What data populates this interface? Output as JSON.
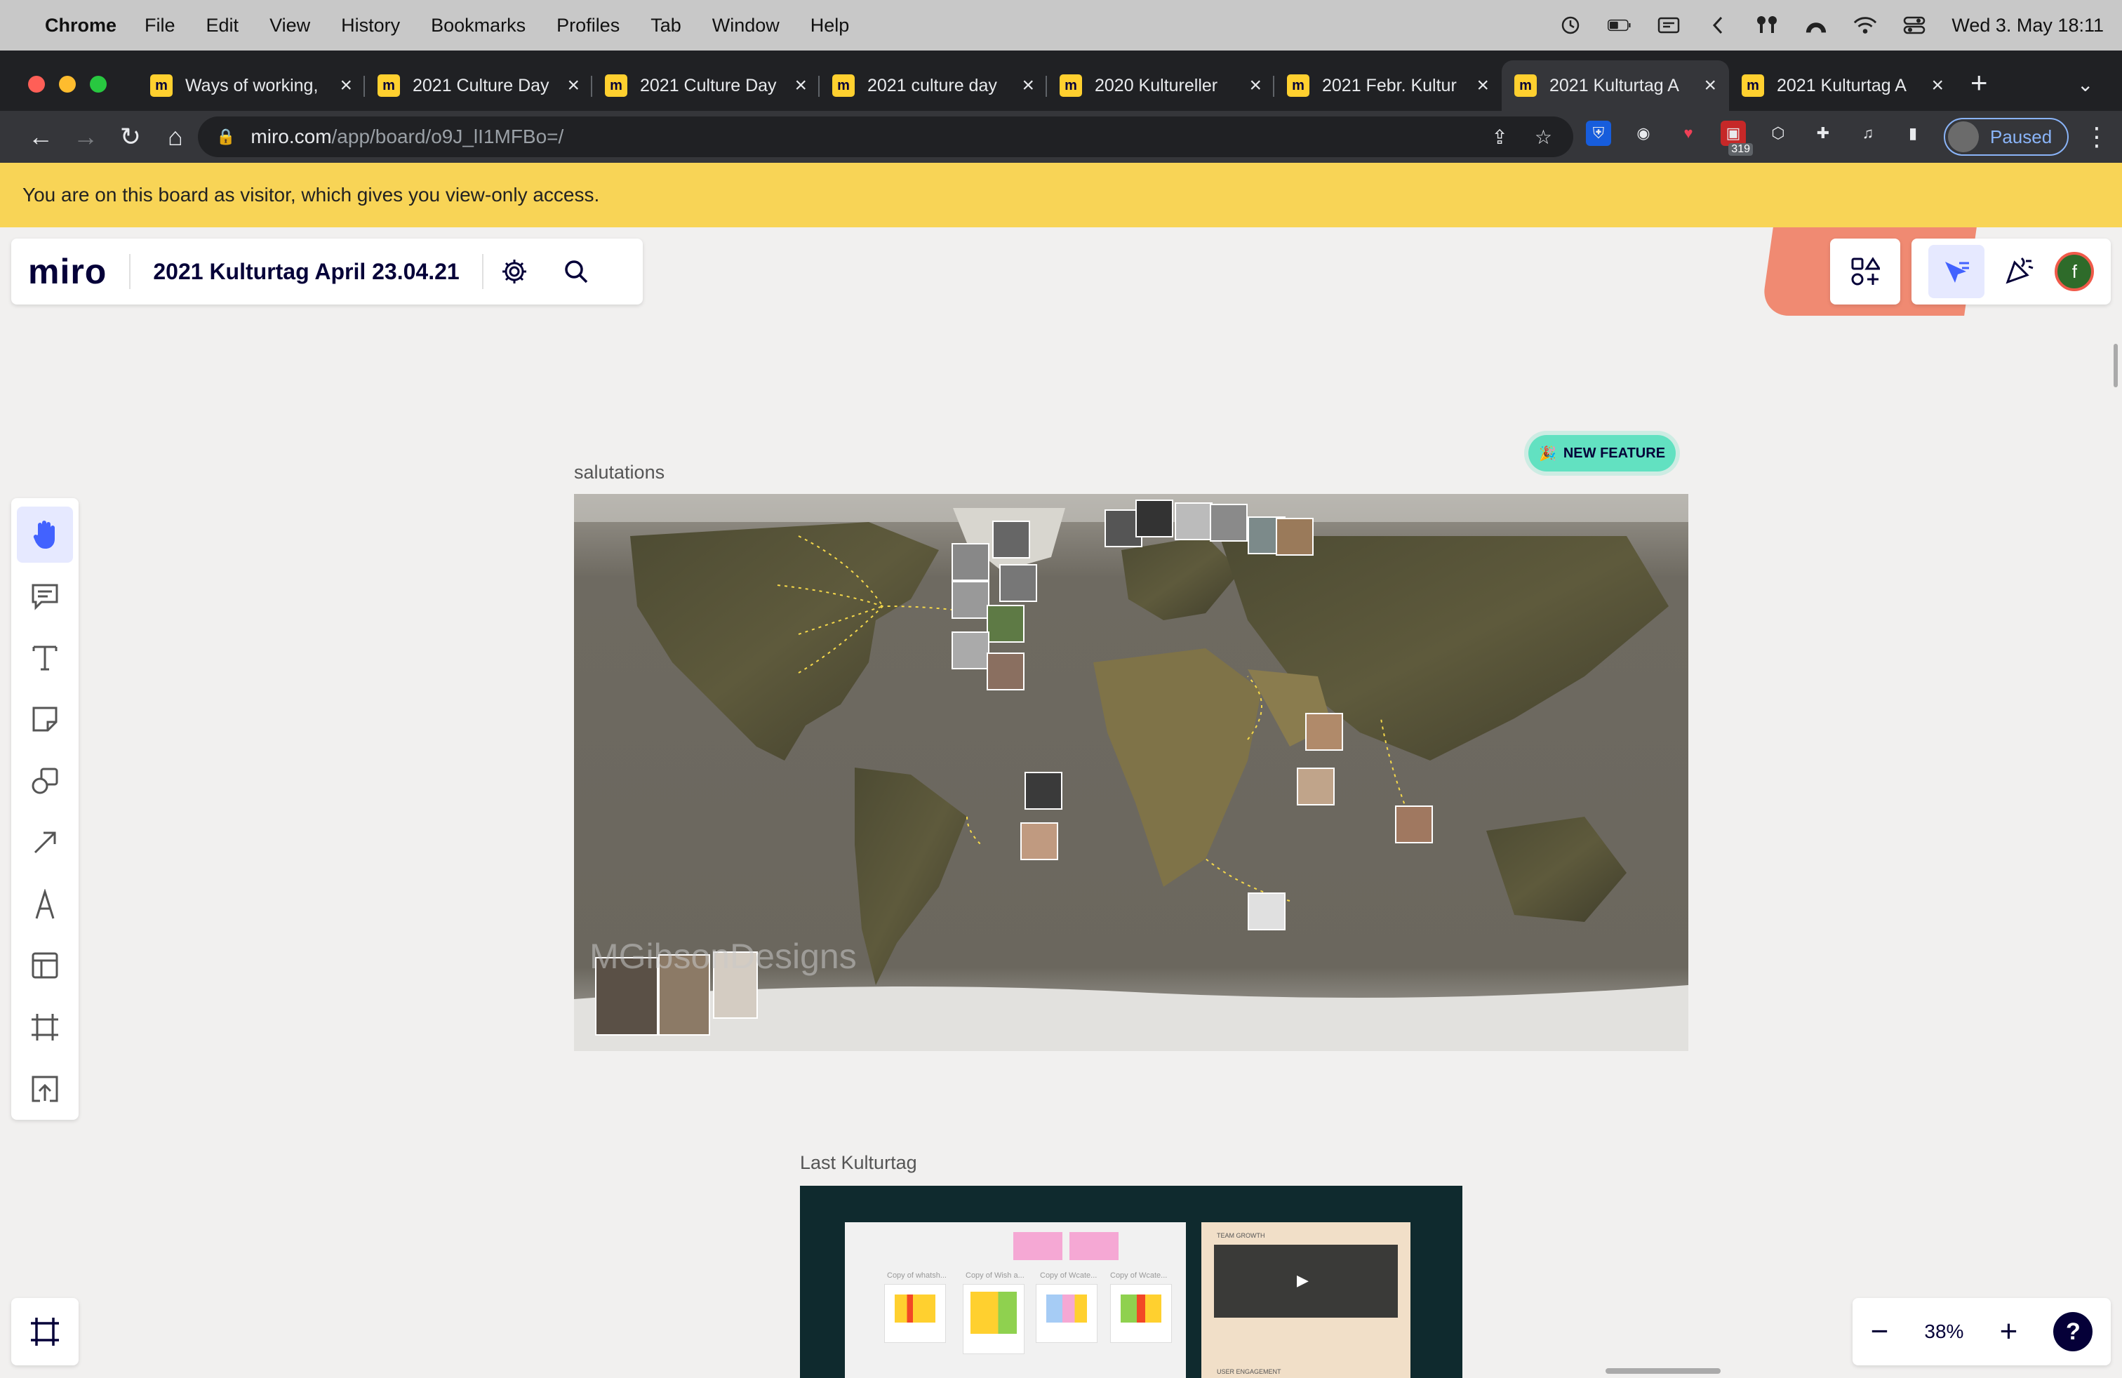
{
  "menubar": {
    "app": "Chrome",
    "items": [
      "File",
      "Edit",
      "View",
      "History",
      "Bookmarks",
      "Profiles",
      "Tab",
      "Window",
      "Help"
    ],
    "datetime": "Wed 3. May  18:11"
  },
  "tabs": [
    {
      "title": "Ways of working,"
    },
    {
      "title": "2021 Culture Day"
    },
    {
      "title": "2021 Culture Day"
    },
    {
      "title": "2021 culture day"
    },
    {
      "title": "2020 Kultureller"
    },
    {
      "title": "2021 Febr. Kultur"
    },
    {
      "title": "2021 Kulturtag A"
    },
    {
      "title": "2021 Kulturtag A"
    }
  ],
  "address": {
    "host": "miro.com",
    "path": "/app/board/o9J_lI1MFBo=/"
  },
  "extensions": {
    "badge": "319"
  },
  "profile": {
    "label": "Paused"
  },
  "banner": {
    "text": "You are on this board as visitor, which gives you view-only access."
  },
  "board": {
    "logo": "miro",
    "title": "2021 Kulturtag April 23.04.21",
    "avatar_initial": "f"
  },
  "canvas": {
    "frame1_label": "salutations",
    "new_feature": "NEW FEATURE",
    "watermark": "MGibsonDesigns",
    "frame2_label": "Last Kulturtag",
    "frame2_white_cols": [
      "Copy of whatsh...",
      "Copy of Wish a...",
      "Copy of Wcate...",
      "Copy of Wcate..."
    ],
    "frame2_beige_heading1": "TEAM GROWTH",
    "frame2_beige_heading2": "USER ENGAGEMENT"
  },
  "zoom": {
    "level": "38%",
    "minus": "−",
    "plus": "+",
    "help": "?"
  }
}
